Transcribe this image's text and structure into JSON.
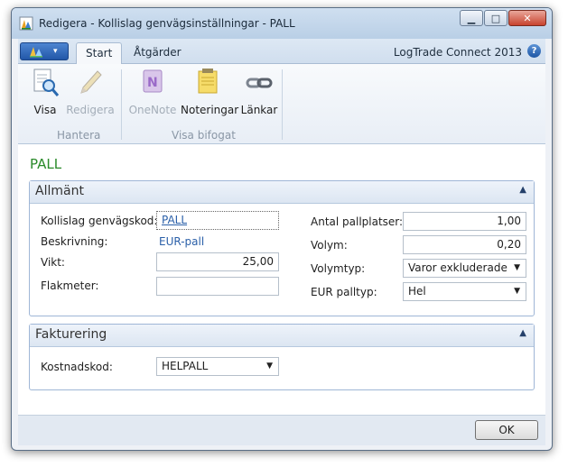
{
  "window": {
    "title": "Redigera - Kollislag genvägsinställningar - PALL",
    "minimize": "▁",
    "maximize": "□",
    "close": "✕"
  },
  "tabs": {
    "app_menu_arrow": "▾",
    "start": "Start",
    "actions": "Åtgärder",
    "brand": "LogTrade Connect 2013",
    "help": "?"
  },
  "ribbon": {
    "buttons": {
      "visa": "Visa",
      "redigera": "Redigera",
      "onenote": "OneNote",
      "noteringar": "Noteringar",
      "lankar": "Länkar"
    },
    "groups": {
      "hantera": "Hantera",
      "visa_bifogat": "Visa bifogat"
    },
    "icons": [
      "view-page-icon",
      "edit-pencil-icon",
      "onenote-icon",
      "notes-icon",
      "links-icon"
    ]
  },
  "page": {
    "title": "PALL"
  },
  "allmant": {
    "header": "Allmänt",
    "collapse": "▲",
    "left": {
      "kollislag_label": "Kollislag genvägskod:",
      "kollislag_value": "PALL",
      "beskrivning_label": "Beskrivning:",
      "beskrivning_value": "EUR-pall",
      "vikt_label": "Vikt:",
      "vikt_value": "25,00",
      "flakmeter_label": "Flakmeter:",
      "flakmeter_value": ""
    },
    "right": {
      "antal_label": "Antal pallplatser:",
      "antal_value": "1,00",
      "volym_label": "Volym:",
      "volym_value": "0,20",
      "volymtyp_label": "Volymtyp:",
      "volymtyp_value": "Varor exkluderade",
      "palltyp_label": "EUR palltyp:",
      "palltyp_value": "Hel"
    }
  },
  "fakturering": {
    "header": "Fakturering",
    "collapse": "▲",
    "kostnadskod_label": "Kostnadskod:",
    "kostnadskod_value": "HELPALL"
  },
  "footer": {
    "ok": "OK"
  },
  "colors": {
    "accent": "#2a8a2a",
    "link": "#2a5fa8",
    "section_border": "#9fb6d6"
  }
}
